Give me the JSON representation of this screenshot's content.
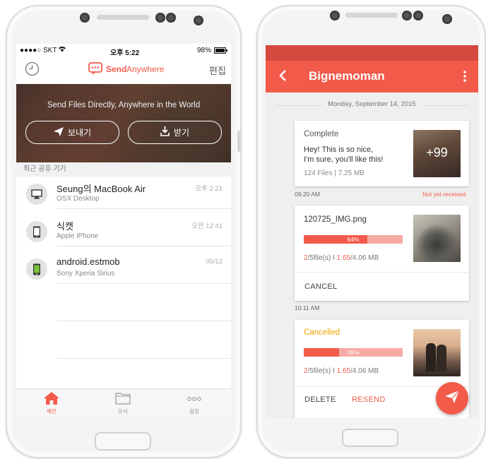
{
  "left_phone": {
    "status": {
      "carrier": "●●●●○ SKT",
      "time": "오후 5:22",
      "battery": "98%"
    },
    "nav": {
      "brand_a": "Send",
      "brand_b": "Anywhere",
      "edit": "편집",
      "history_icon": "clock-icon"
    },
    "hero": {
      "title": "Send Files Directly, Anywhere in the World",
      "send_label": "보내기",
      "receive_label": "받기"
    },
    "section_label": "최근 공유 기기",
    "devices": [
      {
        "name": "Seung의 MacBook Air",
        "sub": "OSX Desktop",
        "time": "오후 2:21",
        "icon": "desktop-icon"
      },
      {
        "name": "식캣",
        "sub": "Apple iPhone",
        "time": "오전 12:41",
        "icon": "apple-phone-icon"
      },
      {
        "name": "android.estmob",
        "sub": "Sony Xperia Sirius",
        "time": "05/12",
        "icon": "android-phone-icon"
      }
    ],
    "tabs": [
      {
        "label": "메인",
        "icon": "home-icon"
      },
      {
        "label": "문서",
        "icon": "folder-icon"
      },
      {
        "label": "설정",
        "icon": "more-icon"
      }
    ]
  },
  "right_phone": {
    "appbar": {
      "title": "Bignemoman"
    },
    "date": "Monday, September 14, 2015",
    "cards": [
      {
        "status": "Complete",
        "message_line1": "Hey! This is so nice,",
        "message_line2": "I'm sure, you'll like this!",
        "info": "124 Files | 7.25 MB",
        "thumb_overlay": "+99",
        "time": "09:20 AM",
        "note": "Not yet received"
      },
      {
        "filename": "120725_IMG.png",
        "progress_label": "64%",
        "progress": 0.64,
        "meta_count": "2",
        "meta_files": "/5file(s) I ",
        "meta_size": "1.65",
        "meta_total": "/4.06 MB",
        "action": "CANCEL",
        "time": "10:11 AM"
      },
      {
        "status": "Cancelled",
        "progress_label": "36%",
        "progress": 0.36,
        "meta_count": "2",
        "meta_files": "/5file(s) I ",
        "meta_size": "1.65",
        "meta_total": "/4.06 MB",
        "action_delete": "DELETE",
        "action_resend": "RESEND"
      }
    ],
    "fab_icon": "send-plane-icon"
  },
  "colors": {
    "accent": "#f25a4a",
    "accent_dark": "#d4483d",
    "cancelled": "#f0a500"
  }
}
